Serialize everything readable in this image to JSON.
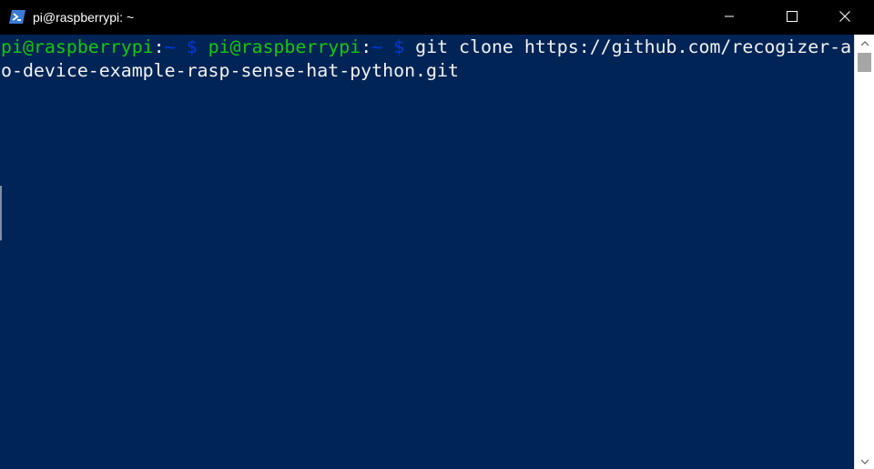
{
  "window": {
    "title": "pi@raspberrypi: ~",
    "app_icon": "powershell-icon",
    "controls": {
      "minimize_icon": "minimize-icon",
      "maximize_icon": "maximize-icon",
      "close_icon": "close-icon"
    }
  },
  "terminal": {
    "line1": {
      "prompt1_user": "pi@raspberrypi",
      "prompt1_sep": ":",
      "prompt1_path": "~ $",
      "gap": " ",
      "prompt2_user": "pi@raspberrypi",
      "prompt2_sep": ":",
      "prompt2_path": "~ $",
      "command": " git clone https://github.com/recogizer-a"
    },
    "line2": {
      "text": "o-device-example-rasp-sense-hat-python.git"
    }
  },
  "scrollbar": {
    "up_icon": "scroll-up-arrow-icon",
    "down_icon": "scroll-down-arrow-icon"
  },
  "colors": {
    "background": "#012456",
    "titlebar": "#000000",
    "prompt_user": "#16c60c",
    "prompt_path": "#0037da",
    "text": "#f2f2f2"
  }
}
